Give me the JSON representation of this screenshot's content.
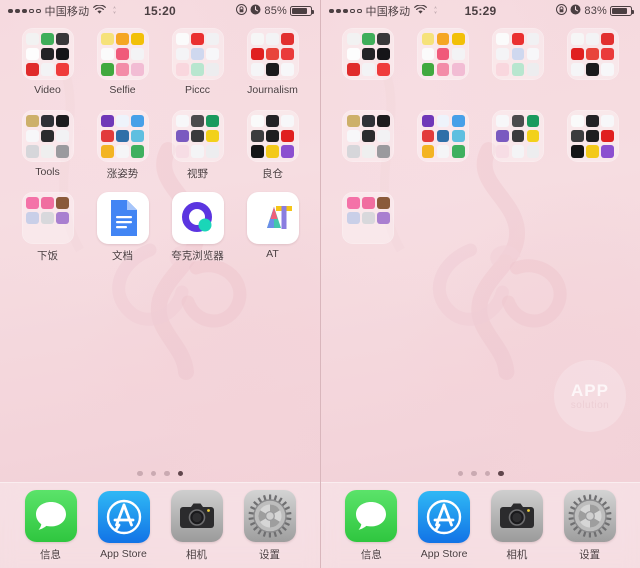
{
  "screens": [
    {
      "id": "left",
      "status": {
        "signal_dots": [
          true,
          true,
          true,
          false,
          false
        ],
        "carrier": "中国移动",
        "wifi_icon": "wifi-icon",
        "sync_icon": "sync-icon",
        "time": "15:20",
        "lock_icon": "rotation-lock-icon",
        "alarm_icon": "alarm-icon",
        "battery_pct": "85%",
        "battery_level": 85
      },
      "labels_visible": true,
      "page_dots": {
        "count": 4,
        "active_index": 3
      },
      "watermark": null,
      "rows": [
        [
          {
            "type": "folder",
            "name": "Video",
            "label": "Video",
            "minis": [
              "#f2f2f2",
              "#3fae5a",
              "#39383a",
              "#fdfdfd",
              "#232326",
              "#151518",
              "#e02b2b",
              "#f3f3f5",
              "#ef3b3b"
            ]
          },
          {
            "type": "folder",
            "name": "Selfie",
            "label": "Selfie",
            "minis": [
              "#f6e27a",
              "#f5a623",
              "#f2c007",
              "#fbfbfb",
              "#f05a7a",
              "#f3f3f5",
              "#41a93f",
              "#f38ca8",
              "#f2bcd4"
            ]
          },
          {
            "type": "folder",
            "name": "Piccc",
            "label": "Piccc",
            "minis": [
              "#fbfbfb",
              "#ea3030",
              "#f1f1f3",
              "#f4f4f6",
              "#cfd8ef",
              "#f7f7f9",
              "#f9d7de",
              "#b8e6cf",
              "#ededef"
            ]
          },
          {
            "type": "folder",
            "name": "Journalism",
            "label": "Journalism",
            "minis": [
              "#f6f6f6",
              "#f3f3f5",
              "#e23030",
              "#e02020",
              "#e8453c",
              "#ea3b3b",
              "#f5f5f7",
              "#1a1a1c",
              "#f7f7f9"
            ]
          }
        ],
        [
          {
            "type": "folder",
            "name": "Tools",
            "label": "Tools",
            "minis": [
              "#cdb06a",
              "#2f3137",
              "#1c1c1e",
              "#f7f7f9",
              "#2b2b2d",
              "#f2f2f4",
              "#d6d6da",
              "#efefef",
              "#9a9a9e"
            ]
          },
          {
            "type": "folder",
            "name": "涨姿势",
            "label": "涨姿势",
            "minis": [
              "#6f38b8",
              "#eef3fb",
              "#46a0e8",
              "#e23b3b",
              "#2f6fa8",
              "#5fbfe0",
              "#f3b423",
              "#f5f5f7",
              "#3fb05f"
            ]
          },
          {
            "type": "folder",
            "name": "视野",
            "label": "视野",
            "minis": [
              "#f7f7f9",
              "#4b4b4d",
              "#1a9a5e",
              "#7a5ac0",
              "#3a3a3c",
              "#f2d11a",
              "#f7dde5",
              "#f4f4f6",
              "#ededef"
            ]
          },
          {
            "type": "folder",
            "name": "良仓",
            "label": "良仓",
            "minis": [
              "#fafafa",
              "#232325",
              "#f7f7f9",
              "#3c3c3e",
              "#1d1d1f",
              "#e02020",
              "#141416",
              "#f3c91a",
              "#8b4fd0"
            ]
          }
        ],
        [
          {
            "type": "folder",
            "name": "下饭",
            "label": "下饭",
            "minis": [
              "#f472a8",
              "#f06ea0",
              "#8a5a3a",
              "#c9cfe8",
              "#d8d8dc",
              "#a97fd0",
              "",
              "",
              ""
            ]
          },
          {
            "type": "app",
            "name": "文档",
            "label": "文档",
            "icon": "google-docs-icon"
          },
          {
            "type": "app",
            "name": "夸克浏览器",
            "label": "夸克浏览器",
            "icon": "quark-browser-icon"
          },
          {
            "type": "app",
            "name": "AT",
            "label": "AT",
            "icon": "at-logo-icon"
          }
        ]
      ],
      "dock": [
        {
          "name": "信息",
          "label": "信息",
          "icon": "messages-icon"
        },
        {
          "name": "App Store",
          "label": "App Store",
          "icon": "app-store-icon"
        },
        {
          "name": "相机",
          "label": "相机",
          "icon": "camera-icon"
        },
        {
          "name": "设置",
          "label": "设置",
          "icon": "settings-icon"
        }
      ]
    },
    {
      "id": "right",
      "status": {
        "signal_dots": [
          true,
          true,
          true,
          false,
          false
        ],
        "carrier": "中国移动",
        "wifi_icon": "wifi-icon",
        "sync_icon": "sync-icon",
        "time": "15:29",
        "lock_icon": "rotation-lock-icon",
        "alarm_icon": "alarm-icon",
        "battery_pct": "83%",
        "battery_level": 83
      },
      "labels_visible": false,
      "page_dots": {
        "count": 4,
        "active_index": 3
      },
      "watermark": {
        "line1": "APP",
        "line2": "solution"
      },
      "rows": [
        [
          {
            "type": "folder",
            "name": "Video",
            "label": "",
            "minis": [
              "#f2f2f2",
              "#3fae5a",
              "#39383a",
              "#fdfdfd",
              "#232326",
              "#151518",
              "#e02b2b",
              "#f3f3f5",
              "#ef3b3b"
            ]
          },
          {
            "type": "folder",
            "name": "Selfie",
            "label": "",
            "minis": [
              "#f6e27a",
              "#f5a623",
              "#f2c007",
              "#fbfbfb",
              "#f05a7a",
              "#f3f3f5",
              "#41a93f",
              "#f38ca8",
              "#f2bcd4"
            ]
          },
          {
            "type": "folder",
            "name": "Piccc",
            "label": "",
            "minis": [
              "#fbfbfb",
              "#ea3030",
              "#f1f1f3",
              "#f4f4f6",
              "#cfd8ef",
              "#f7f7f9",
              "#f9d7de",
              "#b8e6cf",
              "#ededef"
            ]
          },
          {
            "type": "folder",
            "name": "Journalism",
            "label": "",
            "minis": [
              "#f6f6f6",
              "#f3f3f5",
              "#e23030",
              "#e02020",
              "#e8453c",
              "#ea3b3b",
              "#f5f5f7",
              "#1a1a1c",
              "#f7f7f9"
            ]
          }
        ],
        [
          {
            "type": "folder",
            "name": "Tools",
            "label": "",
            "minis": [
              "#cdb06a",
              "#2f3137",
              "#1c1c1e",
              "#f7f7f9",
              "#2b2b2d",
              "#f2f2f4",
              "#d6d6da",
              "#efefef",
              "#9a9a9e"
            ]
          },
          {
            "type": "folder",
            "name": "涨姿势",
            "label": "",
            "minis": [
              "#6f38b8",
              "#eef3fb",
              "#46a0e8",
              "#e23b3b",
              "#2f6fa8",
              "#5fbfe0",
              "#f3b423",
              "#f5f5f7",
              "#3fb05f"
            ]
          },
          {
            "type": "folder",
            "name": "视野",
            "label": "",
            "minis": [
              "#f7f7f9",
              "#4b4b4d",
              "#1a9a5e",
              "#7a5ac0",
              "#3a3a3c",
              "#f2d11a",
              "#f7dde5",
              "#f4f4f6",
              "#ededef"
            ]
          },
          {
            "type": "folder",
            "name": "良仓",
            "label": "",
            "minis": [
              "#fafafa",
              "#232325",
              "#f7f7f9",
              "#3c3c3e",
              "#1d1d1f",
              "#e02020",
              "#141416",
              "#f3c91a",
              "#8b4fd0"
            ]
          }
        ],
        [
          {
            "type": "folder",
            "name": "下饭",
            "label": "",
            "minis": [
              "#f472a8",
              "#f06ea0",
              "#8a5a3a",
              "#c9cfe8",
              "#d8d8dc",
              "#a97fd0",
              "",
              "",
              ""
            ]
          },
          {
            "type": "empty"
          },
          {
            "type": "empty"
          },
          {
            "type": "empty"
          }
        ]
      ],
      "dock": [
        {
          "name": "信息",
          "label": "信息",
          "icon": "messages-icon"
        },
        {
          "name": "App Store",
          "label": "App Store",
          "icon": "app-store-icon"
        },
        {
          "name": "相机",
          "label": "相机",
          "icon": "camera-icon"
        },
        {
          "name": "设置",
          "label": "设置",
          "icon": "settings-icon"
        }
      ]
    }
  ]
}
